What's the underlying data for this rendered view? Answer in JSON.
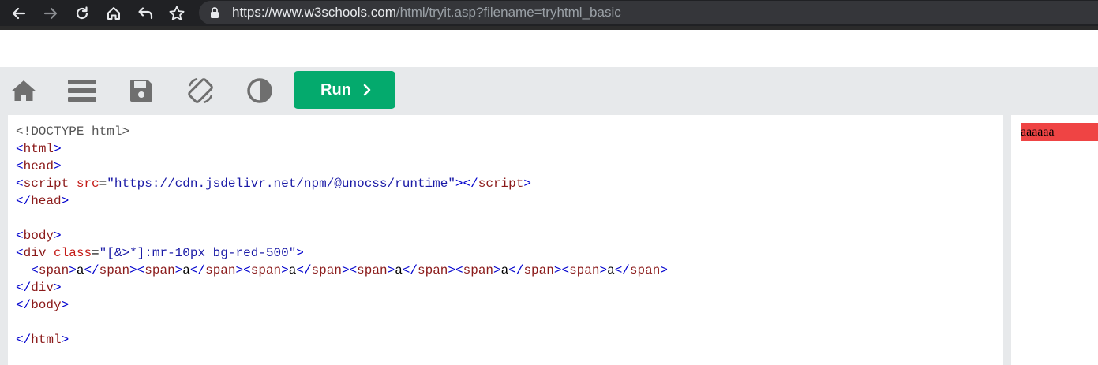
{
  "browser": {
    "url_host": "https://www.w3schools.com",
    "url_path": "/html/tryit.asp?filename=tryhtml_basic",
    "nav_icons": [
      "back-arrow-icon",
      "forward-arrow-icon",
      "reload-icon",
      "home-icon",
      "undo-icon",
      "bookmark-star-icon"
    ]
  },
  "toolbar": {
    "icons": [
      "home-icon",
      "menu-icon",
      "save-icon",
      "rotate-icon",
      "contrast-icon"
    ],
    "run_label": "Run",
    "run_color": "#04aa6d"
  },
  "editor": {
    "lines": [
      [
        [
          "doc",
          "<!DOCTYPE html>"
        ]
      ],
      [
        [
          "br",
          "<"
        ],
        [
          "tag",
          "html"
        ],
        [
          "br",
          ">"
        ]
      ],
      [
        [
          "br",
          "<"
        ],
        [
          "tag",
          "head"
        ],
        [
          "br",
          ">"
        ]
      ],
      [
        [
          "br",
          "<"
        ],
        [
          "tag",
          "script"
        ],
        [
          "text",
          " "
        ],
        [
          "attr",
          "src"
        ],
        [
          "text",
          "="
        ],
        [
          "str",
          "\"https://cdn.jsdelivr.net/npm/@unocss/runtime\""
        ],
        [
          "br",
          ">"
        ],
        [
          "br",
          "</"
        ],
        [
          "tag",
          "script"
        ],
        [
          "br",
          ">"
        ]
      ],
      [
        [
          "br",
          "</"
        ],
        [
          "tag",
          "head"
        ],
        [
          "br",
          ">"
        ]
      ],
      [],
      [
        [
          "br",
          "<"
        ],
        [
          "tag",
          "body"
        ],
        [
          "br",
          ">"
        ]
      ],
      [
        [
          "br",
          "<"
        ],
        [
          "tag",
          "div"
        ],
        [
          "text",
          " "
        ],
        [
          "attr",
          "class"
        ],
        [
          "text",
          "="
        ],
        [
          "str",
          "\"[&>*]:mr-10px bg-red-500\""
        ],
        [
          "br",
          ">"
        ]
      ],
      [
        [
          "text",
          "  "
        ],
        [
          "br",
          "<"
        ],
        [
          "tag",
          "span"
        ],
        [
          "br",
          ">"
        ],
        [
          "text",
          "a"
        ],
        [
          "br",
          "</"
        ],
        [
          "tag",
          "span"
        ],
        [
          "br",
          ">"
        ],
        [
          "br",
          "<"
        ],
        [
          "tag",
          "span"
        ],
        [
          "br",
          ">"
        ],
        [
          "text",
          "a"
        ],
        [
          "br",
          "</"
        ],
        [
          "tag",
          "span"
        ],
        [
          "br",
          ">"
        ],
        [
          "br",
          "<"
        ],
        [
          "tag",
          "span"
        ],
        [
          "br",
          ">"
        ],
        [
          "text",
          "a"
        ],
        [
          "br",
          "</"
        ],
        [
          "tag",
          "span"
        ],
        [
          "br",
          ">"
        ],
        [
          "br",
          "<"
        ],
        [
          "tag",
          "span"
        ],
        [
          "br",
          ">"
        ],
        [
          "text",
          "a"
        ],
        [
          "br",
          "</"
        ],
        [
          "tag",
          "span"
        ],
        [
          "br",
          ">"
        ],
        [
          "br",
          "<"
        ],
        [
          "tag",
          "span"
        ],
        [
          "br",
          ">"
        ],
        [
          "text",
          "a"
        ],
        [
          "br",
          "</"
        ],
        [
          "tag",
          "span"
        ],
        [
          "br",
          ">"
        ],
        [
          "br",
          "<"
        ],
        [
          "tag",
          "span"
        ],
        [
          "br",
          ">"
        ],
        [
          "text",
          "a"
        ],
        [
          "br",
          "</"
        ],
        [
          "tag",
          "span"
        ],
        [
          "br",
          ">"
        ]
      ],
      [
        [
          "br",
          "</"
        ],
        [
          "tag",
          "div"
        ],
        [
          "br",
          ">"
        ]
      ],
      [
        [
          "br",
          "</"
        ],
        [
          "tag",
          "body"
        ],
        [
          "br",
          ">"
        ]
      ],
      [],
      [
        [
          "br",
          "</"
        ],
        [
          "tag",
          "html"
        ],
        [
          "br",
          ">"
        ]
      ]
    ]
  },
  "result": {
    "text": "aaaaaa",
    "background": "#ef4444"
  }
}
